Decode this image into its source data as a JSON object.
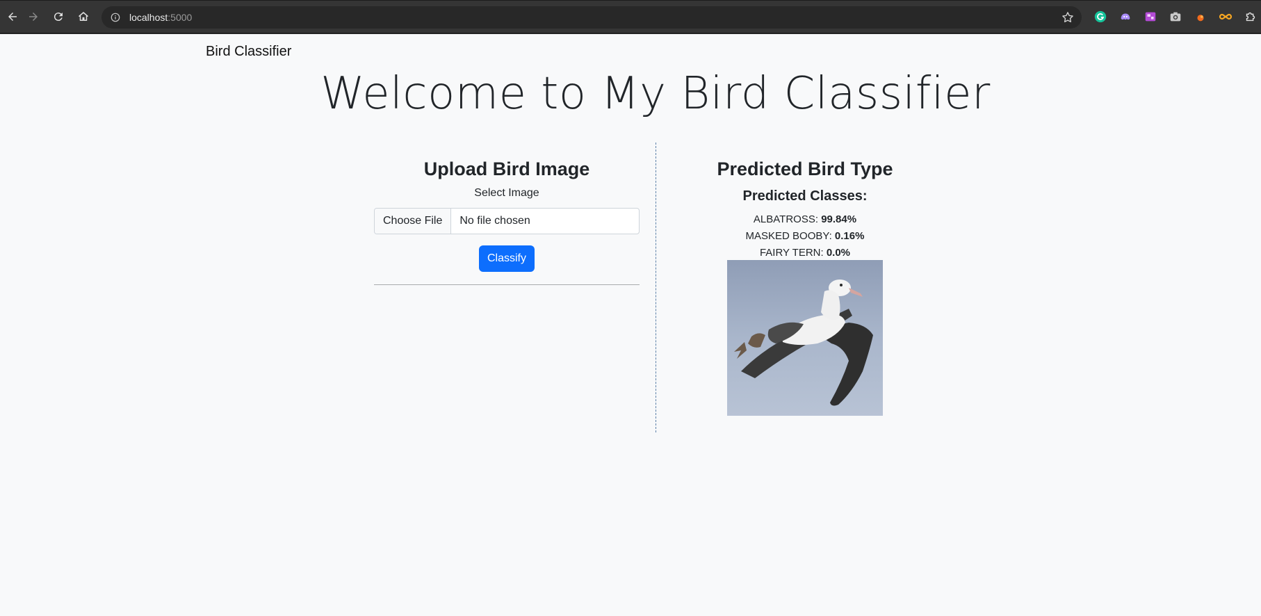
{
  "browser": {
    "url_host": "localhost",
    "url_port": ":5000"
  },
  "navbar": {
    "brand": "Bird Classifier"
  },
  "hero": {
    "title": "Welcome to My Bird Classifier"
  },
  "upload": {
    "heading": "Upload Bird Image",
    "select_label": "Select Image",
    "choose_file_label": "Choose File",
    "file_status": "No file chosen",
    "classify_label": "Classify"
  },
  "prediction": {
    "heading": "Predicted Bird Type",
    "subheading": "Predicted Classes:",
    "classes": [
      {
        "name": "ALBATROSS:",
        "value": "99.84%"
      },
      {
        "name": "MASKED BOOBY:",
        "value": "0.16%"
      },
      {
        "name": "FAIRY TERN:",
        "value": "0.0%"
      }
    ]
  },
  "colors": {
    "primary": "#0d6efd",
    "background": "#f8f9fa",
    "chrome": "#353535"
  }
}
